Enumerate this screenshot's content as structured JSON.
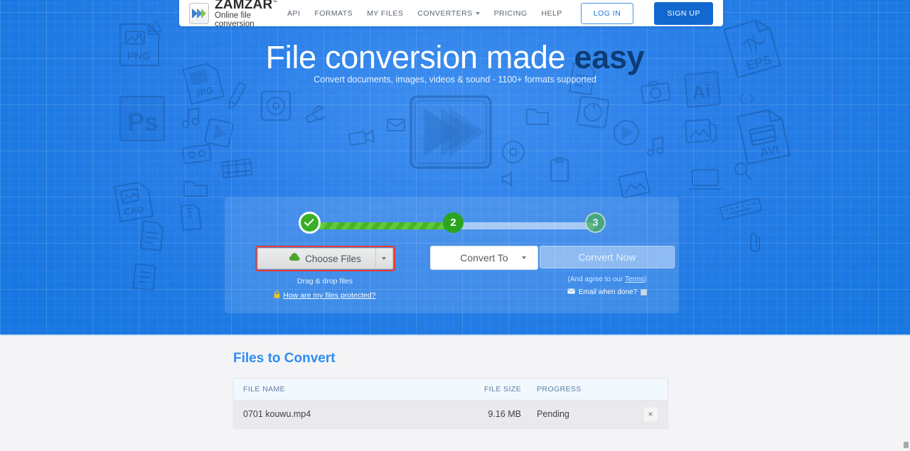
{
  "header": {
    "logo": {
      "title": "ZAMZAR",
      "tm": "™",
      "subtitle": "Online file conversion",
      "icon": "zamzar-chevrons-logo"
    },
    "nav": [
      {
        "label": "API",
        "has_caret": false
      },
      {
        "label": "FORMATS",
        "has_caret": false
      },
      {
        "label": "MY FILES",
        "has_caret": false
      },
      {
        "label": "CONVERTERS",
        "has_caret": true
      },
      {
        "label": "PRICING",
        "has_caret": false
      },
      {
        "label": "HELP",
        "has_caret": false
      }
    ],
    "login_label": "LOG IN",
    "signup_label": "SIGN UP"
  },
  "hero": {
    "title_plain": "File conversion made ",
    "title_bold": "easy",
    "subtitle": "Convert documents, images, videos & sound - 1100+ formats supported",
    "doodle_labels": [
      "PNG",
      "JPG",
      "PS",
      "CAD",
      "EPS",
      "Ai",
      "AVI"
    ],
    "center_icon": "play-fast-forward-sketch"
  },
  "widget": {
    "steps": [
      {
        "id": 1,
        "label": "✓",
        "state": "complete"
      },
      {
        "id": 2,
        "label": "2",
        "state": "active"
      },
      {
        "id": 3,
        "label": "3",
        "state": "inactive"
      }
    ],
    "choose_files": {
      "label": "Choose Files",
      "icon": "cloud-upload-icon",
      "dropdown_icon": "caret-down-icon",
      "highlighted": true,
      "highlight_color": "#ef3b2d"
    },
    "drag_drop_hint": "Drag & drop files",
    "protected_link": "How are my files protected?",
    "protected_icon": "lock-icon",
    "convert_to": {
      "label": "Convert To",
      "icon": "caret-down-icon"
    },
    "convert_now": {
      "label": "Convert Now",
      "disabled": true
    },
    "terms_prefix": "(And agree to our ",
    "terms_link": "Terms",
    "terms_suffix": ")",
    "email_when_done": "Email when done?",
    "email_icon": "envelope-icon",
    "email_checked": false
  },
  "files_section": {
    "title_plain": "Files to ",
    "title_accent": "Convert",
    "columns": [
      "FILE NAME",
      "FILE SIZE",
      "PROGRESS",
      ""
    ],
    "rows": [
      {
        "name": "0701 kouwu.mp4",
        "size": "9.16 MB",
        "progress": "Pending",
        "remove_icon": "×"
      }
    ]
  },
  "colors": {
    "hero_blue": "#1877e0",
    "accent_blue": "#2d8cf0",
    "green_done": "#37af27",
    "green_active": "#2ba520",
    "highlight_red": "#ef3b2d",
    "page_gray": "#f4f4f6"
  }
}
